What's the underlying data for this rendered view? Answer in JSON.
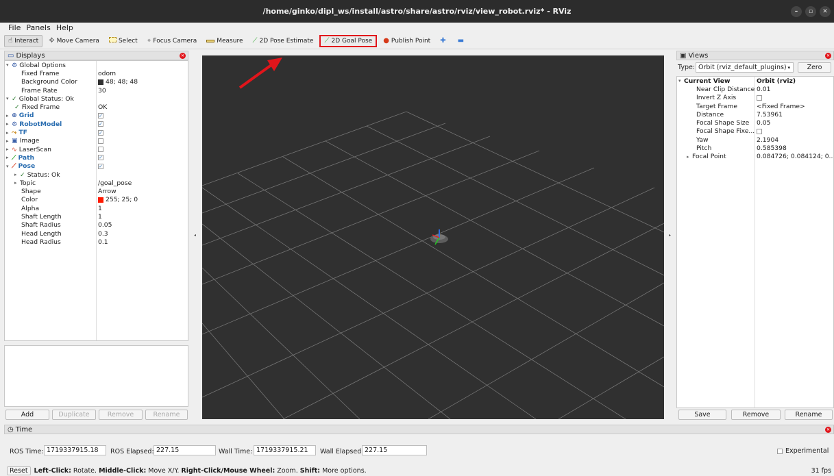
{
  "window": {
    "title": "/home/ginko/dipl_ws/install/astro/share/astro/rviz/view_robot.rviz* - RViz"
  },
  "menu": [
    "File",
    "Panels",
    "Help"
  ],
  "toolbar": {
    "interact": "Interact",
    "move_camera": "Move Camera",
    "select": "Select",
    "focus_camera": "Focus Camera",
    "measure": "Measure",
    "pose_estimate": "2D Pose Estimate",
    "goal_pose": "2D Goal Pose",
    "publish_point": "Publish Point"
  },
  "displays": {
    "title": "Displays",
    "rows": [
      {
        "label": "Global Options",
        "value": ""
      },
      {
        "label": "Fixed Frame",
        "value": "odom"
      },
      {
        "label": "Background Color",
        "value": "48; 48; 48"
      },
      {
        "label": "Frame Rate",
        "value": "30"
      },
      {
        "label": "Global Status: Ok",
        "value": ""
      },
      {
        "label": "Fixed Frame",
        "value": "OK"
      },
      {
        "label": "Grid",
        "value": ""
      },
      {
        "label": "RobotModel",
        "value": ""
      },
      {
        "label": "TF",
        "value": ""
      },
      {
        "label": "Image",
        "value": ""
      },
      {
        "label": "LaserScan",
        "value": ""
      },
      {
        "label": "Path",
        "value": ""
      },
      {
        "label": "Pose",
        "value": ""
      },
      {
        "label": "Status: Ok",
        "value": ""
      },
      {
        "label": "Topic",
        "value": "/goal_pose"
      },
      {
        "label": "Shape",
        "value": "Arrow"
      },
      {
        "label": "Color",
        "value": "255; 25; 0"
      },
      {
        "label": "Alpha",
        "value": "1"
      },
      {
        "label": "Shaft Length",
        "value": "1"
      },
      {
        "label": "Shaft Radius",
        "value": "0.05"
      },
      {
        "label": "Head Length",
        "value": "0.3"
      },
      {
        "label": "Head Radius",
        "value": "0.1"
      }
    ],
    "buttons": {
      "add": "Add",
      "duplicate": "Duplicate",
      "remove": "Remove",
      "rename": "Rename"
    }
  },
  "views": {
    "title": "Views",
    "type_label": "Type:",
    "type_value": "Orbit (rviz_default_plugins)",
    "zero": "Zero",
    "rows": [
      {
        "label": "Current View",
        "value": "Orbit (rviz)"
      },
      {
        "label": "Near Clip Distance",
        "value": "0.01"
      },
      {
        "label": "Invert Z Axis",
        "value": ""
      },
      {
        "label": "Target Frame",
        "value": "<Fixed Frame>"
      },
      {
        "label": "Distance",
        "value": "7.53961"
      },
      {
        "label": "Focal Shape Size",
        "value": "0.05"
      },
      {
        "label": "Focal Shape Fixe...",
        "value": ""
      },
      {
        "label": "Yaw",
        "value": "2.1904"
      },
      {
        "label": "Pitch",
        "value": "0.585398"
      },
      {
        "label": "Focal Point",
        "value": "0.084726; 0.084124; 0...."
      }
    ],
    "buttons": {
      "save": "Save",
      "remove": "Remove",
      "rename": "Rename"
    }
  },
  "time": {
    "title": "Time",
    "ros_time_label": "ROS Time:",
    "ros_time": "1719337915.18",
    "ros_elapsed_label": "ROS Elapsed:",
    "ros_elapsed": "227.15",
    "wall_time_label": "Wall Time:",
    "wall_time": "1719337915.21",
    "wall_elapsed_label": "Wall Elapsed:",
    "wall_elapsed": "227.15",
    "experimental": "Experimental"
  },
  "status": {
    "reset": "Reset",
    "b1": "Left-Click:",
    "t1": " Rotate. ",
    "b2": "Middle-Click:",
    "t2": " Move X/Y. ",
    "b3": "Right-Click/Mouse Wheel:",
    "t3": " Zoom. ",
    "b4": "Shift:",
    "t4": " More options.",
    "fps": "31 fps"
  },
  "colors": {
    "accent_red": "#e1151b",
    "viewport_bg": "#303030",
    "blue_label": "#2a6db0"
  }
}
